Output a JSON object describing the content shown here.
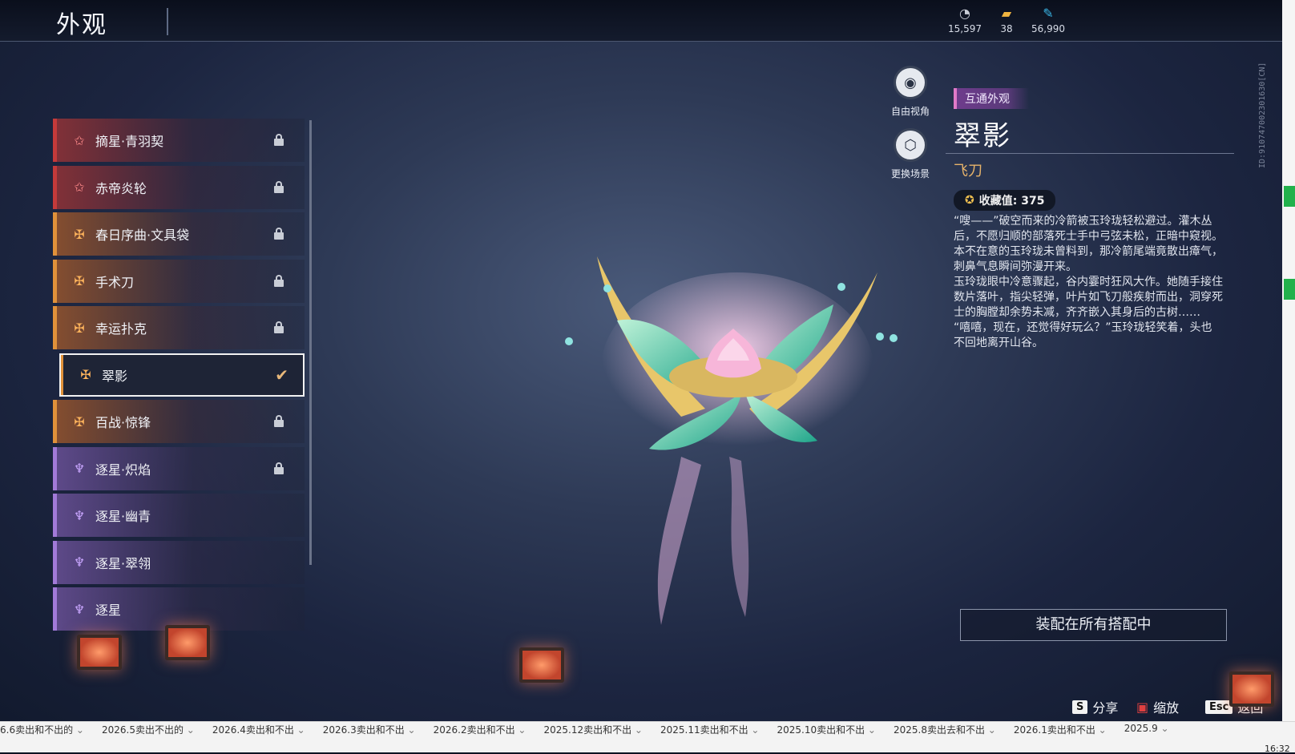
{
  "header": {
    "title": "外观"
  },
  "currencies": [
    {
      "icon": "coin-icon",
      "value": "15,597"
    },
    {
      "icon": "ticket-icon",
      "value": "38"
    },
    {
      "icon": "feather-icon",
      "value": "56,990"
    }
  ],
  "side_id": "ID:910747002301630[CN]",
  "list": {
    "items": [
      {
        "label": "摘星·青羽契",
        "rarity": "red",
        "locked": true,
        "selected": false
      },
      {
        "label": "赤帝炎轮",
        "rarity": "red",
        "locked": true,
        "selected": false
      },
      {
        "label": "春日序曲·文具袋",
        "rarity": "orange",
        "locked": true,
        "selected": false
      },
      {
        "label": "手术刀",
        "rarity": "orange",
        "locked": true,
        "selected": false
      },
      {
        "label": "幸运扑克",
        "rarity": "orange",
        "locked": true,
        "selected": false
      },
      {
        "label": "翠影",
        "rarity": "orange",
        "locked": false,
        "selected": true
      },
      {
        "label": "百战·惊锋",
        "rarity": "orange",
        "locked": true,
        "selected": false
      },
      {
        "label": "逐星·炽焰",
        "rarity": "purple",
        "locked": true,
        "selected": false
      },
      {
        "label": "逐星·幽青",
        "rarity": "purple",
        "locked": false,
        "selected": false
      },
      {
        "label": "逐星·翠翎",
        "rarity": "purple",
        "locked": false,
        "selected": false
      },
      {
        "label": "逐星",
        "rarity": "purple",
        "locked": false,
        "selected": false
      }
    ]
  },
  "view_buttons": {
    "free_view": "自由视角",
    "change_scene": "更换场景"
  },
  "info": {
    "tag": "互通外观",
    "name": "翠影",
    "type": "飞刀",
    "collect_label": "收藏值: 375",
    "description": "“嗖——”破空而来的冷箭被玉玲珑轻松避过。灌木丛后，不愿归顺的部落死士手中弓弦未松，正暗中窥视。\n本不在意的玉玲珑未曾料到，那冷箭尾端竟散出瘴气，刺鼻气息瞬间弥漫开来。\n玉玲珑眼中冷意骤起，谷内霎时狂风大作。她随手接住数片落叶，指尖轻弹，叶片如飞刀般疾射而出，洞穿死士的胸膛却余势未减，齐齐嵌入其身后的古树……\n“嘻嘻，现在，还觉得好玩么？”玉玲珑轻笑着，头也不回地离开山谷。",
    "equip_button": "装配在所有搭配中"
  },
  "hints": [
    {
      "key": "S",
      "label": "分享"
    },
    {
      "key": "",
      "label": "缩放"
    },
    {
      "key": "Esc",
      "label": "返回"
    }
  ],
  "tabs": [
    "6.6卖出和不出的",
    "2026.5卖出不出的",
    "2026.4卖出和不出",
    "2026.3卖出和不出",
    "2026.2卖出和不出",
    "2025.12卖出和不出",
    "2025.11卖出和不出",
    "2025.10卖出和不出",
    "2025.8卖出去和不出",
    "2026.1卖出和不出",
    "2025.9"
  ],
  "clock": "16:32",
  "colors": {
    "red": "#c43a3a",
    "orange": "#e0913a",
    "purple": "#a27ad8",
    "accent": "#e6b36a"
  }
}
